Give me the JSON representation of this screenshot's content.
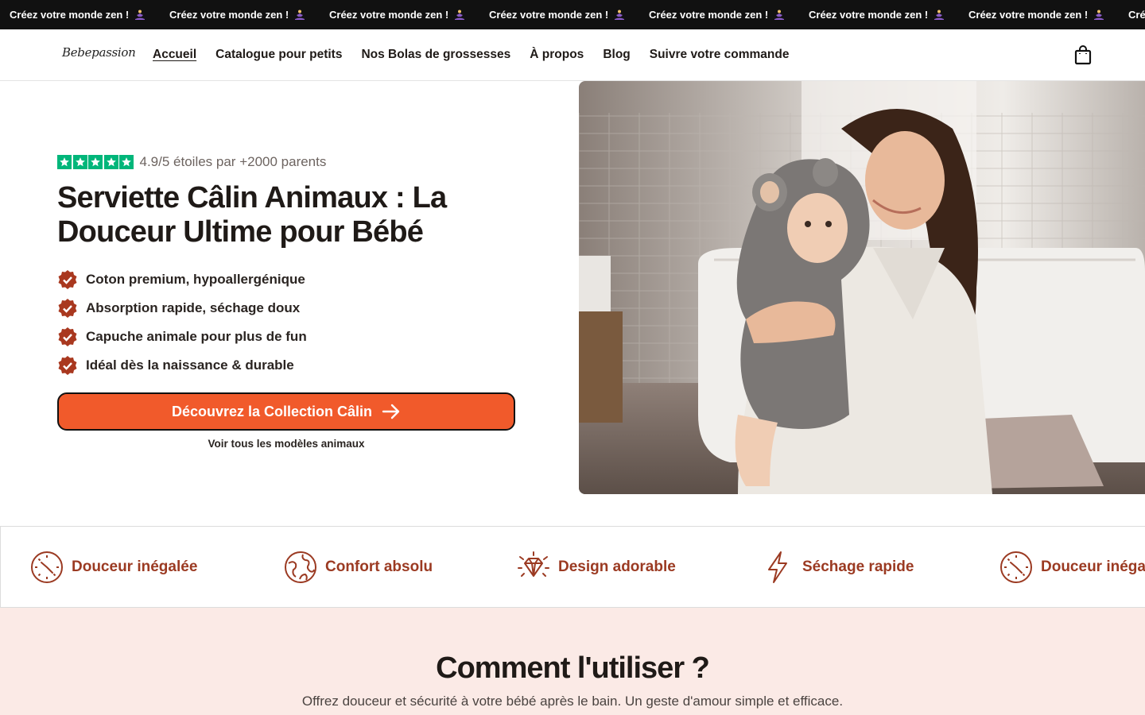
{
  "announcement": {
    "text": "Créez votre monde zen !",
    "icon": "person-meditating-icon",
    "items": [
      "Créez votre monde zen !",
      "Créez votre monde zen !",
      "Créez votre monde zen !",
      "Créez votre monde zen !",
      "Créez votre monde zen !",
      "Créez votre monde zen !",
      "Créez votre monde zen !",
      "Créez votre monde zen !"
    ]
  },
  "header": {
    "logo": "Bebepassion",
    "nav": [
      {
        "label": "Accueil",
        "active": true
      },
      {
        "label": "Catalogue pour petits"
      },
      {
        "label": "Nos Bolas de grossesses"
      },
      {
        "label": "À propos"
      },
      {
        "label": "Blog"
      },
      {
        "label": "Suivre votre commande"
      }
    ],
    "cart_icon": "shopping-bag-icon"
  },
  "hero": {
    "rating": {
      "stars": 5,
      "text": "4.9/5 étoiles par +2000 parents",
      "star_color": "#00b67a"
    },
    "title": "Serviette Câlin Animaux : La Douceur Ultime pour Bébé",
    "features": [
      "Coton premium, hypoallergénique",
      "Absorption rapide, séchage doux",
      "Capuche animale pour plus de fun",
      "Idéal dès la naissance & durable"
    ],
    "cta_label": "Découvrez la Collection Câlin",
    "sub_link": "Voir tous les modèles animaux",
    "image_alt": "Mother holding baby in grey animal hooded towel in a bathroom"
  },
  "benefits": [
    {
      "label": "Douceur inégalée",
      "icon": "clock-icon"
    },
    {
      "label": "Confort absolu",
      "icon": "globe-icon"
    },
    {
      "label": "Design adorable",
      "icon": "diamond-icon"
    },
    {
      "label": "Séchage rapide",
      "icon": "lightning-icon"
    },
    {
      "label": "Douceur inégalée",
      "icon": "clock-icon"
    }
  ],
  "how_to": {
    "title": "Comment l'utiliser ?",
    "subtitle": "Offrez douceur et sécurité à votre bébé après le bain. Un geste d'amour simple et efficace."
  },
  "colors": {
    "accent": "#f15a2b",
    "benefit_text": "#9b3a22",
    "badge": "#a9381f",
    "how_bg": "#fbeae6",
    "marquee_bg": "#111111"
  }
}
